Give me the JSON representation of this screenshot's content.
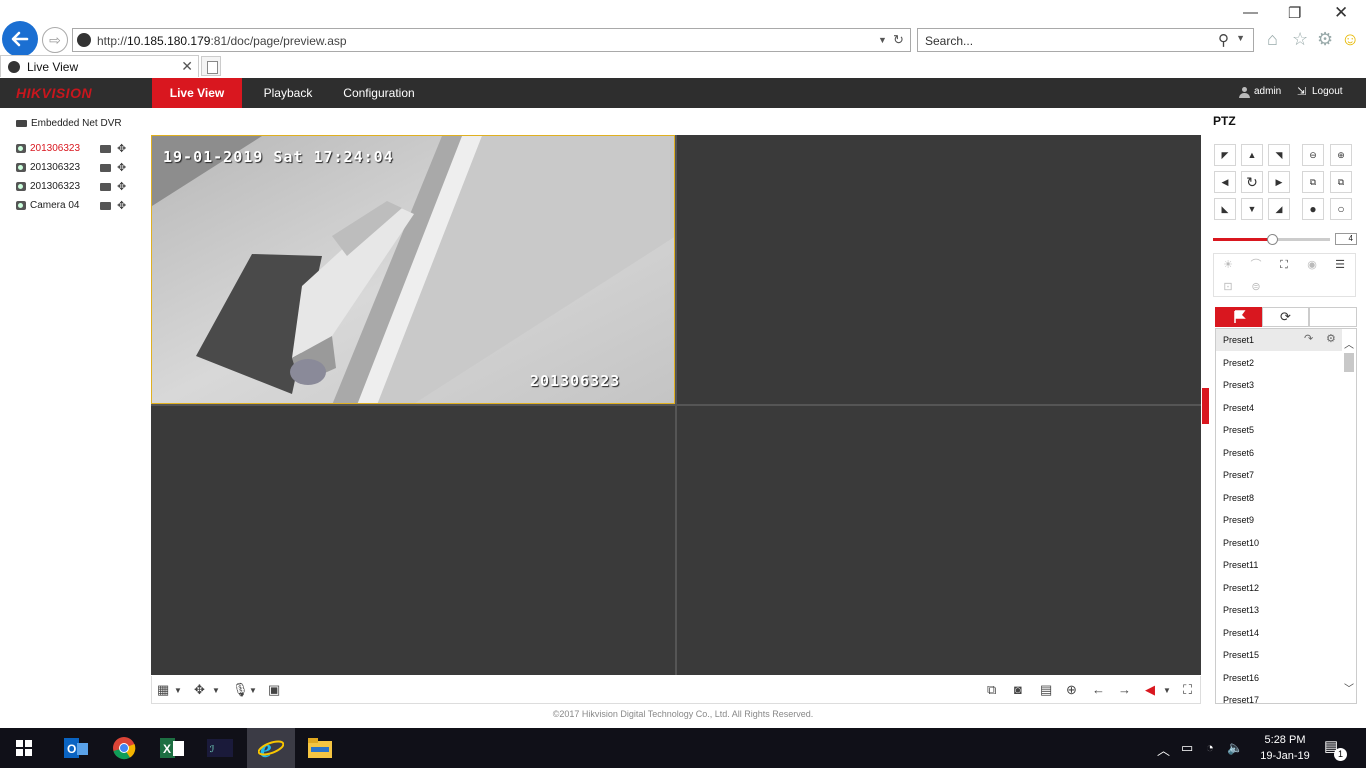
{
  "browser": {
    "url_prefix": "http://",
    "url_host": "10.185.180.179",
    "url_rest": ":81/doc/page/preview.asp",
    "search_placeholder": "Search...",
    "tab_title": "Live View"
  },
  "header": {
    "logo": "HIKVISION",
    "nav": [
      "Live View",
      "Playback",
      "Configuration"
    ],
    "user": "admin",
    "logout": "Logout"
  },
  "tree": {
    "root": "Embedded Net DVR",
    "cameras": [
      {
        "name": "201306323",
        "active": true
      },
      {
        "name": "201306323",
        "active": false
      },
      {
        "name": "201306323",
        "active": false
      },
      {
        "name": "Camera 04",
        "active": false
      }
    ]
  },
  "video": {
    "osd_time": "19-01-2019 Sat 17:24:04",
    "osd_name": "201306323"
  },
  "footer": "©2017 Hikvision Digital Technology Co., Ltd. All Rights Reserved.",
  "ptz": {
    "title": "PTZ",
    "speed": "4",
    "speed_level_fraction": 0.5,
    "presets": [
      "Preset1",
      "Preset2",
      "Preset3",
      "Preset4",
      "Preset5",
      "Preset6",
      "Preset7",
      "Preset8",
      "Preset9",
      "Preset10",
      "Preset11",
      "Preset12",
      "Preset13",
      "Preset14",
      "Preset15",
      "Preset16",
      "Preset17"
    ]
  },
  "taskbar": {
    "time": "5:28 PM",
    "date": "19-Jan-19",
    "notifications": "1"
  },
  "colors": {
    "brand_red": "#d9171f",
    "header_bg": "#2e2e2e",
    "taskbar_bg": "#101018"
  }
}
